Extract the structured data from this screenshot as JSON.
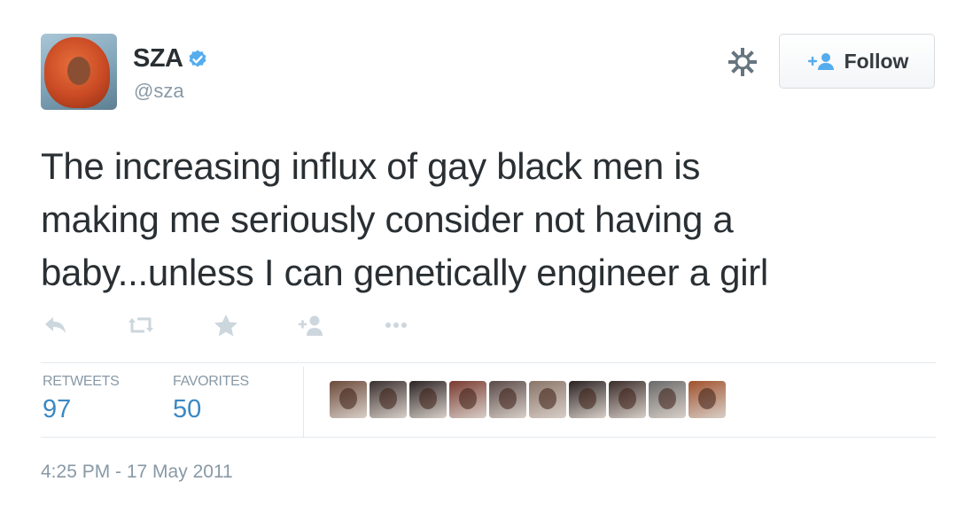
{
  "user": {
    "display_name": "SZA",
    "handle": "@sza",
    "verified": true
  },
  "header": {
    "settings_icon": "gear-icon",
    "follow_label": "Follow",
    "follow_icon": "add-user-icon"
  },
  "tweet": {
    "text_lines": [
      "The increasing influx of gay black men is",
      "making me seriously consider not having a",
      "baby...unless I can genetically engineer a girl"
    ]
  },
  "actions": [
    "reply-icon",
    "retweet-icon",
    "favorite-icon",
    "follow-icon",
    "more-icon"
  ],
  "stats": {
    "retweets_label": "RETWEETS",
    "retweets_count": "97",
    "favorites_label": "FAVORITES",
    "favorites_count": "50"
  },
  "favoriters": [
    "#6b4a3a",
    "#3a3030",
    "#2b2424",
    "#7a3a30",
    "#5a4a48",
    "#8a7468",
    "#2a2222",
    "#3a2c2a",
    "#6a6a6a",
    "#a0522d"
  ],
  "timestamp": "4:25 PM - 17 May 2011",
  "colors": {
    "link_blue": "#3b88c3",
    "muted_gray": "#8899a6",
    "verified_blue": "#55acee"
  }
}
